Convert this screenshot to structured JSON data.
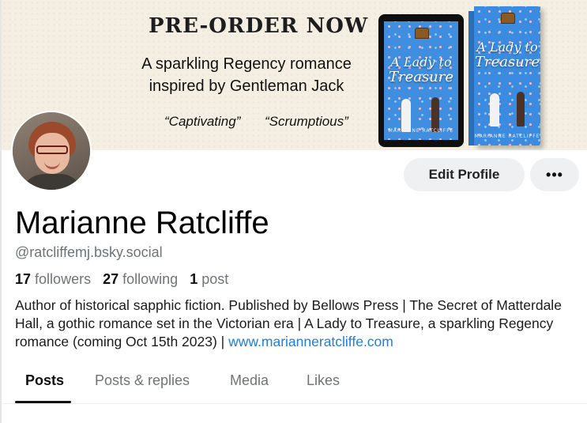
{
  "banner": {
    "preorder": "PRE-ORDER NOW",
    "tagline_line1": "A sparkling Regency romance",
    "tagline_line2": "inspired by Gentleman Jack",
    "quote1": "“Captivating”",
    "quote2": "“Scrumptious”",
    "cover_title_line1": "A Lady to",
    "cover_title_line2": "Treasure",
    "cover_author": "MARIANNE RATCLIFFE",
    "cover_color": "#3f8ee0"
  },
  "actions": {
    "edit_label": "Edit Profile",
    "more_label": "•••"
  },
  "profile": {
    "name": "Marianne Ratcliffe",
    "handle": "@ratcliffemj.bsky.social",
    "followers_count": "17",
    "followers_label": "followers",
    "following_count": "27",
    "following_label": "following",
    "posts_count": "1",
    "posts_label": "post",
    "bio_text": "Author of historical sapphic fiction. Published by Bellows Press | The Secret of Matterdale Hall, a gothic romance set in the Victorian era | A Lady to Treasure, a sparkling Regency romance (coming Oct 15th 2023) | ",
    "bio_link": "www.marianneratcliffe.com",
    "link_color": "#1d7fe0"
  },
  "tabs": [
    {
      "label": "Posts",
      "active": true
    },
    {
      "label": "Posts & replies",
      "active": false
    },
    {
      "label": "Media",
      "active": false
    },
    {
      "label": "Likes",
      "active": false
    }
  ]
}
